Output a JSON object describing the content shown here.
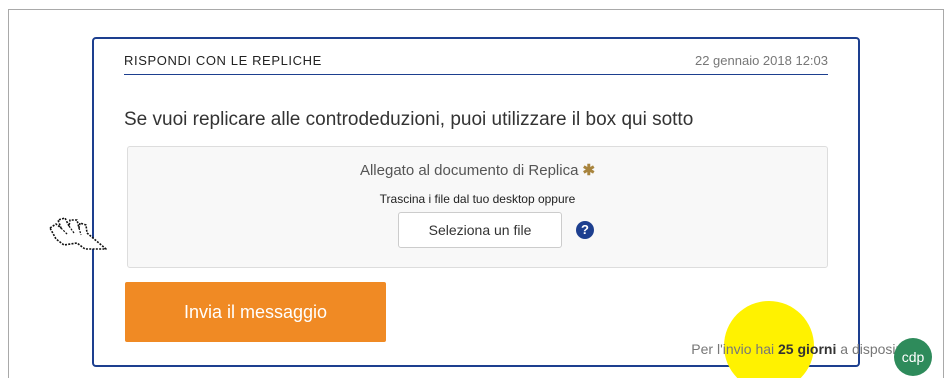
{
  "card": {
    "title": "RISPONDI CON LE REPLICHE",
    "date": "22 gennaio 2018 12:03",
    "intro": "Se vuoi replicare alle controdeduzioni, puoi utilizzare il box qui sotto"
  },
  "upload": {
    "label": "Allegato al documento di Replica",
    "required_mark": "✱",
    "hint": "Trascina i file dal tuo desktop oppure",
    "select_button": "Seleziona un file",
    "help_icon_glyph": "?"
  },
  "actions": {
    "send_button": "Invia il messaggio"
  },
  "deadline": {
    "prefix": "Per l'invio hai",
    "days": "25 giorni",
    "suffix": "a disposizione"
  },
  "badge": {
    "text": "cdp"
  },
  "icons": {
    "cursor": "hand-pointer-icon",
    "help": "question-circle-icon"
  },
  "colors": {
    "accent_blue": "#1d3f8f",
    "button_orange": "#f08a24",
    "highlight_yellow": "#fff200",
    "badge_green": "#2e8b5b"
  }
}
